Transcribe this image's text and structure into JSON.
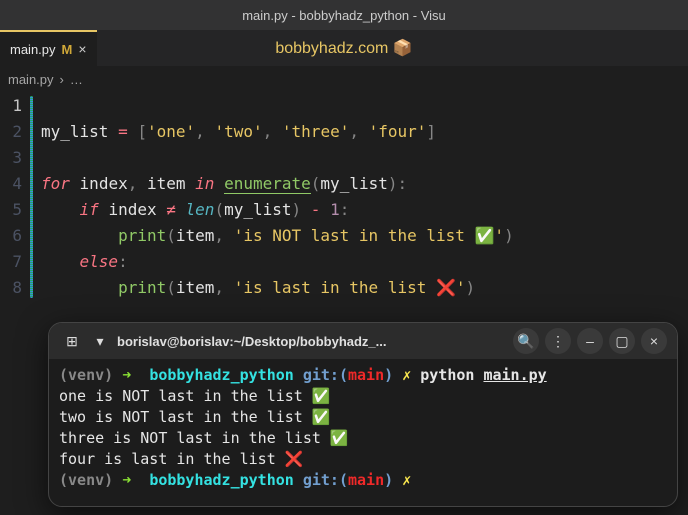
{
  "window": {
    "title": "main.py - bobbyhadz_python - Visu"
  },
  "tab": {
    "name": "main.py",
    "modified_marker": "M",
    "close_glyph": "×"
  },
  "watermark": "bobbyhadz.com 📦",
  "breadcrumbs": {
    "file": "main.py",
    "sep": "›",
    "more": "…"
  },
  "code": {
    "line_numbers": [
      "1",
      "2",
      "3",
      "4",
      "5",
      "6",
      "7",
      "8"
    ],
    "my_list": "my_list",
    "eq": "=",
    "lbr": "[",
    "rbr": "]",
    "comma": ",",
    "s_one": "'one'",
    "s_two": "'two'",
    "s_three": "'three'",
    "s_four": "'four'",
    "for": "for",
    "index": "index",
    "item": "item",
    "in": "in",
    "enumerate": "enumerate",
    "lp": "(",
    "rp": ")",
    "colon": ":",
    "if": "if",
    "neq": "≠",
    "len": "len",
    "minus": "-",
    "one": "1",
    "print": "print",
    "s_not_last": "'is NOT last in the list ✅'",
    "else": "else",
    "s_last": "'is last in the list ❌'"
  },
  "term": {
    "newtab_glyph": "⊞",
    "dropdown_glyph": "▾",
    "title": "borislav@borislav:~/Desktop/bobbyhadz_...",
    "search_glyph": "🔍",
    "menu_glyph": "⋮",
    "min_glyph": "–",
    "max_glyph": "▢",
    "close_glyph": "×",
    "venv": "(venv)",
    "arrow": "➜",
    "dir": "bobbyhadz_python",
    "git": "git:(",
    "branch": "main",
    "git_close": ")",
    "dirty": "✗",
    "cmd_python": "python",
    "cmd_file": "main.py",
    "out1": "one is NOT last in the list ✅",
    "out2": "two is NOT last in the list ✅",
    "out3": "three is NOT last in the list ✅",
    "out4": "four is last in the list ❌"
  }
}
